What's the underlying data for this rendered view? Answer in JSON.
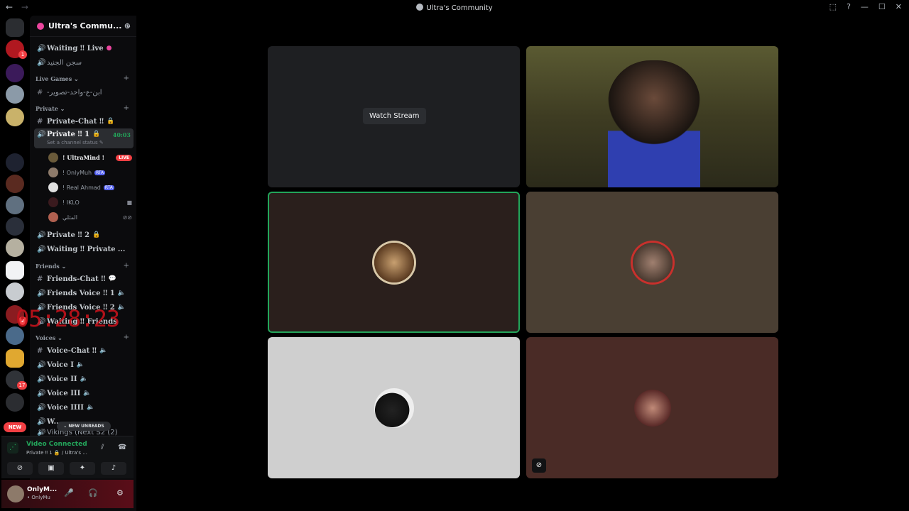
{
  "window": {
    "title": "Ultra's Community",
    "nav_back": "←",
    "nav_forward": "→",
    "controls": [
      "⬚",
      "?",
      "—",
      "☐",
      "✕"
    ]
  },
  "rail": {
    "badges": [
      "1",
      "2",
      "17"
    ],
    "new_label": "NEW"
  },
  "guild": {
    "name": "Ultra's Commu...",
    "chevron": "⌄",
    "invite_icon": "⁺"
  },
  "channels": {
    "waiting_live": "Waiting ‼ Live",
    "sijn": "سجن الجنيد",
    "cat_live_games": "Live Games",
    "live_games_ch": "-ابن-ع-واحد-تصوير",
    "cat_private": "Private",
    "private_chat": "Private-Chat ‼",
    "private_1": "Private ‼ 1",
    "private_1_timer": "40:03",
    "private_1_status": "Set a channel status ✎",
    "private_2": "Private ‼ 2",
    "waiting_private": "Waiting ‼ Private ...",
    "cat_friends": "Friends",
    "friends_chat": "Friends-Chat ‼",
    "friends_voice_1": "Friends Voice ‼ 1",
    "friends_voice_2": "Friends Voice ‼ 2",
    "waiting_friends": "Waiting ‼ Friends",
    "cat_voices": "Voices",
    "voice_chat": "Voice-Chat ‼",
    "voice_1": "Voice I",
    "voice_2": "Voice II",
    "voice_3": "Voice III",
    "voice_4": "Voice IIII",
    "voice_cut": "W...",
    "vikings": "Vikings (Next S2 (2)"
  },
  "members": [
    {
      "name": "! UltraMind !",
      "tag": "LIVE"
    },
    {
      "name": "! OnlyMuh",
      "tag": "RTA"
    },
    {
      "name": "! Real Ahmad",
      "tag": "RTA"
    },
    {
      "name": "! IKLO",
      "tag": ""
    },
    {
      "name": "المثلي",
      "tag": ""
    }
  ],
  "overlay_clock": "05:28:23",
  "new_unreads": "⌄ NEW UNREADS",
  "voice_panel": {
    "status": "Video Connected",
    "subtitle": "Private ‼ 1 🔒 / Ultra's ..."
  },
  "user_panel": {
    "name": "OnlyM...",
    "status": "• OnlyMu"
  },
  "stage": {
    "watch_stream": "Watch Stream"
  },
  "colors": {
    "accent_green": "#23a55a",
    "live_red": "#f23f43",
    "clock_red": "#c3121b"
  }
}
